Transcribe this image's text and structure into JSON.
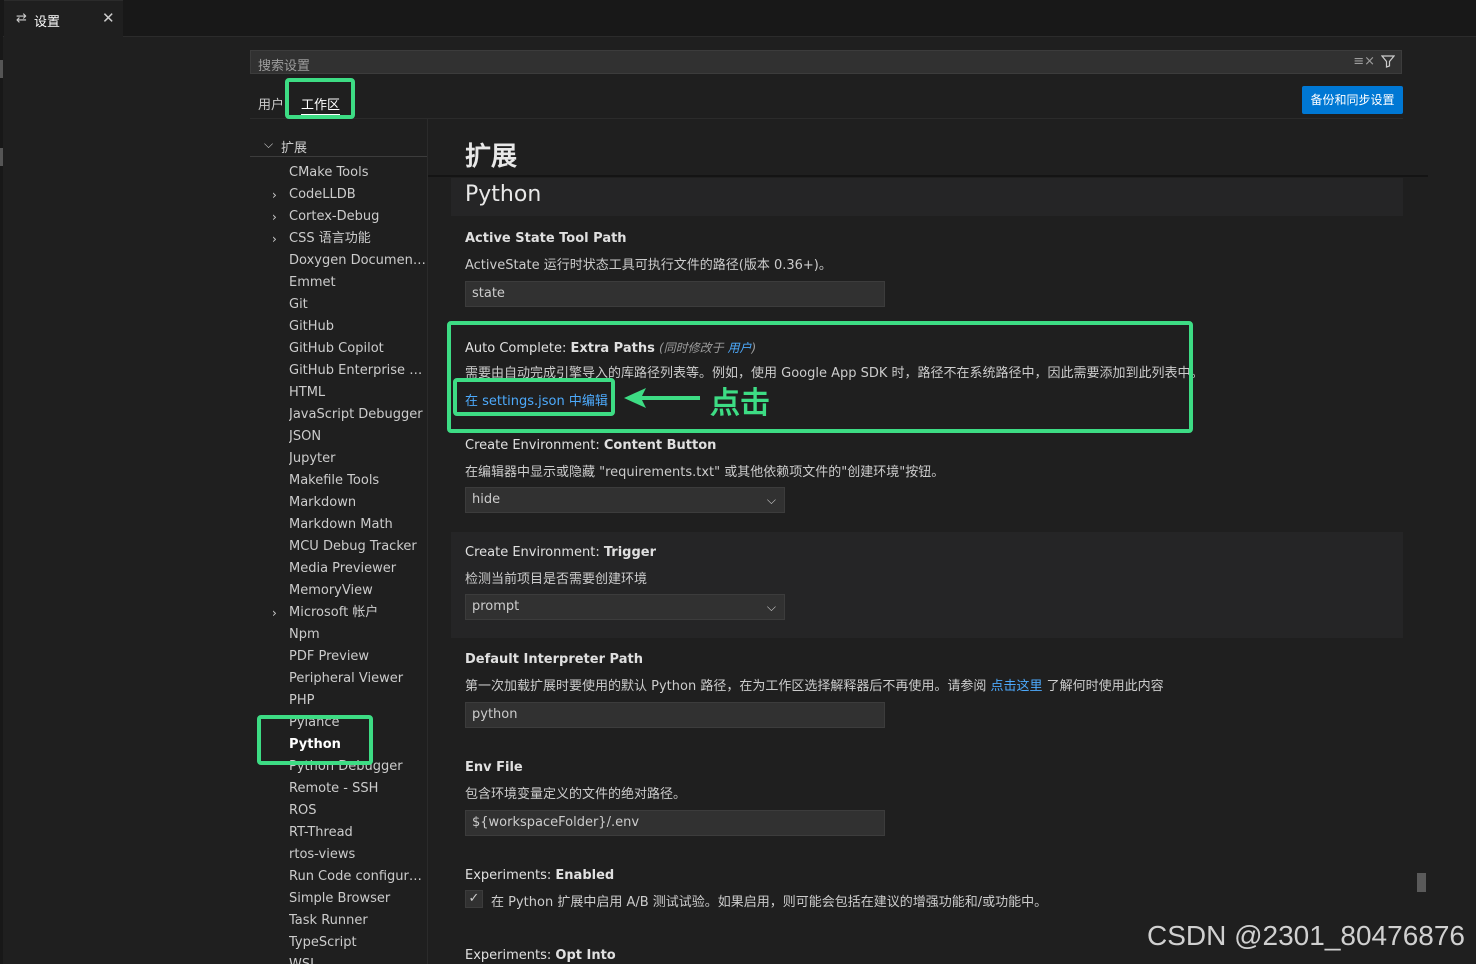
{
  "tab": {
    "icon": "settings-icon",
    "label": "设置",
    "close": "✕"
  },
  "search": {
    "placeholder": "搜索设置",
    "clear_icon": "clear-filter-icon",
    "filter_icon": "filter-icon"
  },
  "scopes": {
    "user": "用户",
    "workspace": "工作区"
  },
  "backup_button": "备份和同步设置",
  "toc": {
    "header": "扩展",
    "items": [
      {
        "label": "CMake Tools",
        "chevron": false
      },
      {
        "label": "CodeLLDB",
        "chevron": true
      },
      {
        "label": "Cortex-Debug",
        "chevron": true
      },
      {
        "label": "CSS 语言功能",
        "chevron": true
      },
      {
        "label": "Doxygen Documentati...",
        "chevron": false
      },
      {
        "label": "Emmet",
        "chevron": false
      },
      {
        "label": "Git",
        "chevron": false
      },
      {
        "label": "GitHub",
        "chevron": false
      },
      {
        "label": "GitHub Copilot",
        "chevron": false
      },
      {
        "label": "GitHub Enterprise Ser...",
        "chevron": false
      },
      {
        "label": "HTML",
        "chevron": false
      },
      {
        "label": "JavaScript Debugger",
        "chevron": false
      },
      {
        "label": "JSON",
        "chevron": false
      },
      {
        "label": "Jupyter",
        "chevron": false
      },
      {
        "label": "Makefile Tools",
        "chevron": false
      },
      {
        "label": "Markdown",
        "chevron": false
      },
      {
        "label": "Markdown Math",
        "chevron": false
      },
      {
        "label": "MCU Debug Tracker",
        "chevron": false
      },
      {
        "label": "Media Previewer",
        "chevron": false
      },
      {
        "label": "MemoryView",
        "chevron": false
      },
      {
        "label": "Microsoft 帐户",
        "chevron": true
      },
      {
        "label": "Npm",
        "chevron": false
      },
      {
        "label": "PDF Preview",
        "chevron": false
      },
      {
        "label": "Peripheral Viewer",
        "chevron": false
      },
      {
        "label": "PHP",
        "chevron": false
      },
      {
        "label": "Pylance",
        "chevron": false
      },
      {
        "label": "Python",
        "chevron": false,
        "active": true
      },
      {
        "label": "Python Debugger",
        "chevron": false
      },
      {
        "label": "Remote - SSH",
        "chevron": false
      },
      {
        "label": "ROS",
        "chevron": false
      },
      {
        "label": "RT-Thread",
        "chevron": false
      },
      {
        "label": "rtos-views",
        "chevron": false
      },
      {
        "label": "Run Code configuration",
        "chevron": false
      },
      {
        "label": "Simple Browser",
        "chevron": false
      },
      {
        "label": "Task Runner",
        "chevron": false
      },
      {
        "label": "TypeScript",
        "chevron": false
      },
      {
        "label": "WSL",
        "chevron": false
      }
    ]
  },
  "main": {
    "section_title": "扩展",
    "group_title": "Python",
    "settings": {
      "active_state": {
        "title_prefix": "",
        "title_name": "Active State Tool Path",
        "description": "ActiveState 运行时状态工具可执行文件的路径(版本 0.36+)。",
        "value": "state"
      },
      "auto_complete": {
        "title_prefix": "Auto Complete: ",
        "title_name": "Extra Paths",
        "modified_prefix": "(同时修改于 ",
        "modified_link": "用户",
        "modified_suffix": ")",
        "description": "需要由自动完成引擎导入的库路径列表等。例如，使用 Google App SDK 时，路径不在系统路径中，因此需要添加到此列表中。",
        "edit_link": "在 settings.json 中编辑"
      },
      "create_env_button": {
        "title_prefix": "Create Environment: ",
        "title_name": "Content Button",
        "description": "在编辑器中显示或隐藏 \"requirements.txt\" 或其他依赖项文件的\"创建环境\"按钮。",
        "value": "hide"
      },
      "create_env_trigger": {
        "title_prefix": "Create Environment: ",
        "title_name": "Trigger",
        "description": "检测当前项目是否需要创建环境",
        "value": "prompt"
      },
      "default_interpreter": {
        "title_prefix": "",
        "title_name": "Default Interpreter Path",
        "description_before": "第一次加载扩展时要使用的默认 Python 路径，在为工作区选择解释器后不再使用。请参阅 ",
        "description_link": "点击这里",
        "description_after": " 了解何时使用此内容",
        "value": "python"
      },
      "env_file": {
        "title_prefix": "",
        "title_name": "Env File",
        "description": "包含环境变量定义的文件的绝对路径。",
        "value": "${workspaceFolder}/.env"
      },
      "experiments_enabled": {
        "title_prefix": "Experiments: ",
        "title_name": "Enabled",
        "checked": true,
        "description": "在 Python 扩展中启用 A/B 测试试验。如果启用，则可能会包括在建议的增强功能和/或功能中。"
      },
      "experiments_opt_into": {
        "title_prefix": "Experiments: ",
        "title_name": "Opt Into"
      }
    }
  },
  "annotation": {
    "click_label": "点击",
    "color": "#3ddc84"
  },
  "watermark": "CSDN @2301_80476876",
  "colors": {
    "accent": "#0078d4",
    "link": "#4daafc",
    "highlight": "#3ddc84"
  }
}
